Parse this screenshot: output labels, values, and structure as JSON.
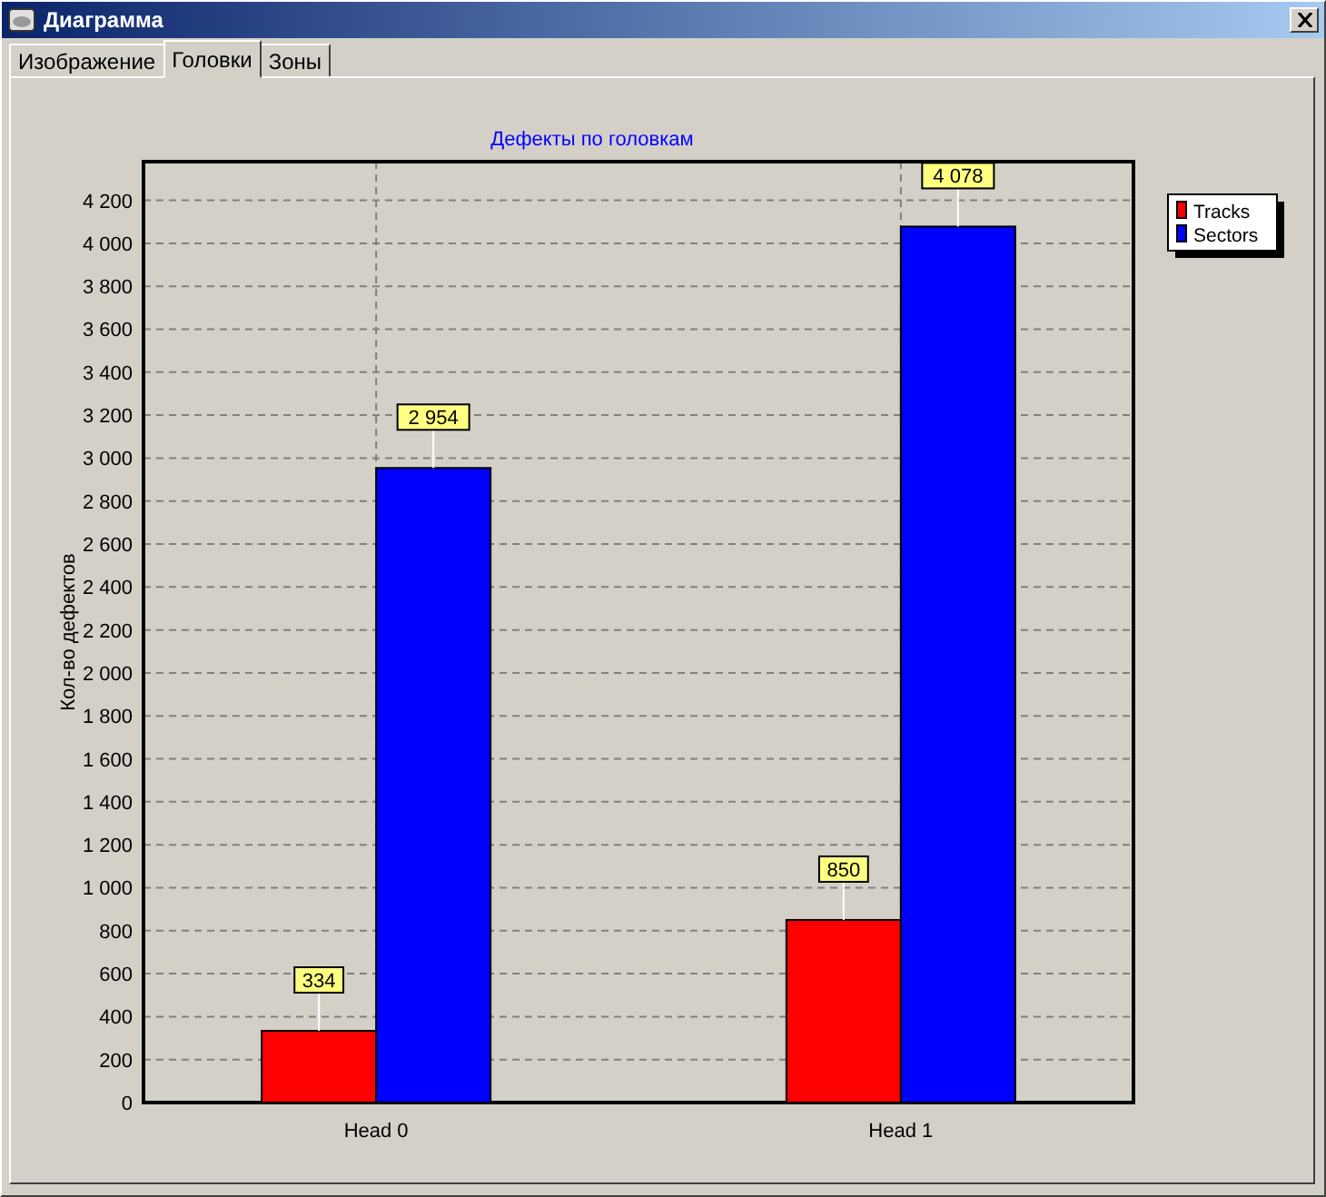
{
  "window": {
    "title": "Диаграмма"
  },
  "tabs": [
    {
      "label": "Изображение",
      "selected": false
    },
    {
      "label": "Головки",
      "selected": true
    },
    {
      "label": "Зоны",
      "selected": false
    }
  ],
  "chart_data": {
    "type": "bar",
    "title": "Дефекты по головкам",
    "ylabel": "Кол-во дефектов",
    "categories": [
      "Head 0",
      "Head 1"
    ],
    "series": [
      {
        "name": "Tracks",
        "color": "#ff0000",
        "values": [
          334,
          850
        ]
      },
      {
        "name": "Sectors",
        "color": "#0000ff",
        "values": [
          2954,
          4078
        ]
      }
    ],
    "ylim": [
      0,
      4380
    ],
    "yticks": [
      {
        "value": 0,
        "label": "0"
      },
      {
        "value": 200,
        "label": "200"
      },
      {
        "value": 400,
        "label": "400"
      },
      {
        "value": 600,
        "label": "600"
      },
      {
        "value": 800,
        "label": "800"
      },
      {
        "value": 1000,
        "label": "1 000"
      },
      {
        "value": 1200,
        "label": "1 200"
      },
      {
        "value": 1400,
        "label": "1 400"
      },
      {
        "value": 1600,
        "label": "1 600"
      },
      {
        "value": 1800,
        "label": "1 800"
      },
      {
        "value": 2000,
        "label": "2 000"
      },
      {
        "value": 2200,
        "label": "2 200"
      },
      {
        "value": 2400,
        "label": "2 400"
      },
      {
        "value": 2600,
        "label": "2 600"
      },
      {
        "value": 2800,
        "label": "2 800"
      },
      {
        "value": 3000,
        "label": "3 000"
      },
      {
        "value": 3200,
        "label": "3 200"
      },
      {
        "value": 3400,
        "label": "3 400"
      },
      {
        "value": 3600,
        "label": "3 600"
      },
      {
        "value": 3800,
        "label": "3 800"
      },
      {
        "value": 4000,
        "label": "4 000"
      },
      {
        "value": 4200,
        "label": "4 200"
      }
    ],
    "grid": true,
    "legend": true,
    "data_labels": true,
    "value_labels": [
      [
        "334",
        "850"
      ],
      [
        "2 954",
        "4 078"
      ]
    ]
  }
}
